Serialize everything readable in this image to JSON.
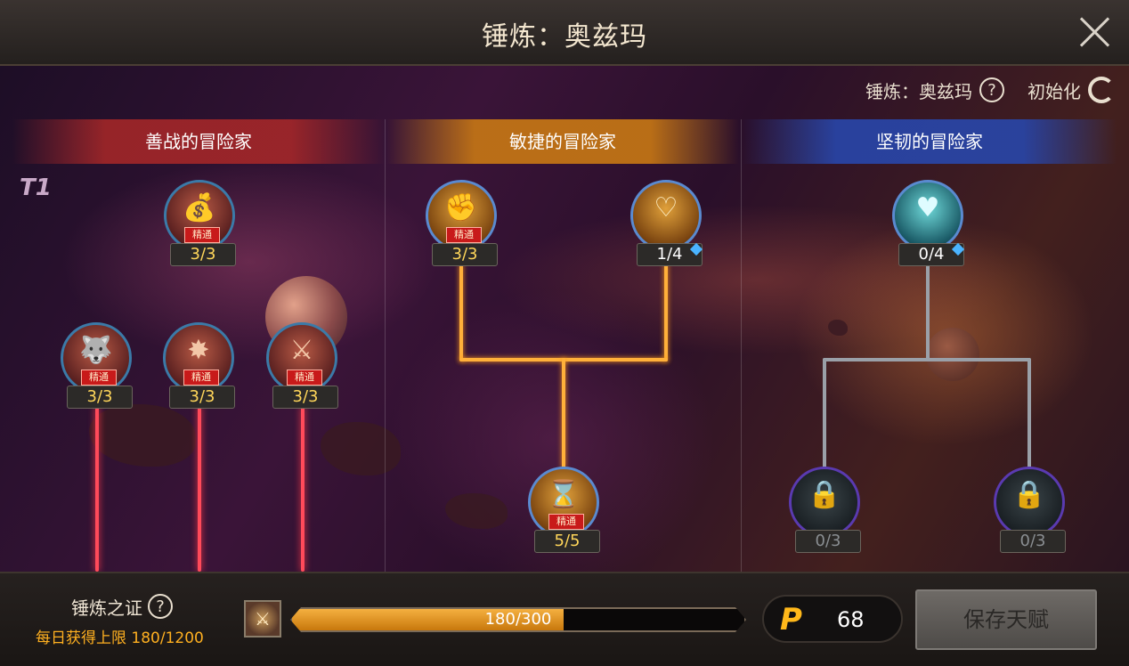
{
  "window": {
    "title": "锤炼：奥兹玛"
  },
  "top_info": {
    "label": "锤炼：奥兹玛",
    "help_icon": "help-icon",
    "reset_label": "初始化",
    "reset_icon": "reset-icon"
  },
  "tier_label": "T1",
  "columns": [
    {
      "name": "善战的冒险家",
      "color": "#aa2828"
    },
    {
      "name": "敏捷的冒险家",
      "color": "#c87814"
    },
    {
      "name": "坚韧的冒险家",
      "color": "#2846aa"
    }
  ],
  "skills": {
    "c1_top": {
      "level": "3/3",
      "badge": "精通",
      "icon": "sack-icon",
      "glyph": "💰"
    },
    "c1_a": {
      "level": "3/3",
      "badge": "精通",
      "icon": "beast-icon",
      "glyph": "🐺"
    },
    "c1_b": {
      "level": "3/3",
      "badge": "精通",
      "icon": "burst-icon",
      "glyph": "✸"
    },
    "c1_c": {
      "level": "3/3",
      "badge": "精通",
      "icon": "blade-icon",
      "glyph": "⚔"
    },
    "c2_a": {
      "level": "3/3",
      "badge": "精通",
      "icon": "fist-icon",
      "glyph": "✊"
    },
    "c2_b": {
      "level": "1/4",
      "icon": "heart-plus-icon",
      "glyph": "♡"
    },
    "c2_c": {
      "level": "5/5",
      "badge": "精通",
      "icon": "hourglass-icon",
      "glyph": "⌛"
    },
    "c3_a": {
      "level": "0/4",
      "icon": "heart-icon",
      "glyph": "♥"
    },
    "c3_b": {
      "level": "0/3",
      "icon": "lock-icon",
      "glyph": "🔒"
    },
    "c3_c": {
      "level": "0/3",
      "icon": "lock-icon",
      "glyph": "🔒"
    }
  },
  "bottom": {
    "proof_label": "锤炼之证",
    "daily_limit": "每日获得上限 180/1200",
    "progress_text": "180/300",
    "progress_value": 0.6,
    "currency_symbol": "P",
    "currency_value": "68",
    "save_label": "保存天赋"
  },
  "colors": {
    "accent_orange": "#ffb03a",
    "accent_red": "#ff4a5a",
    "accent_blue": "#4ab4ff"
  }
}
